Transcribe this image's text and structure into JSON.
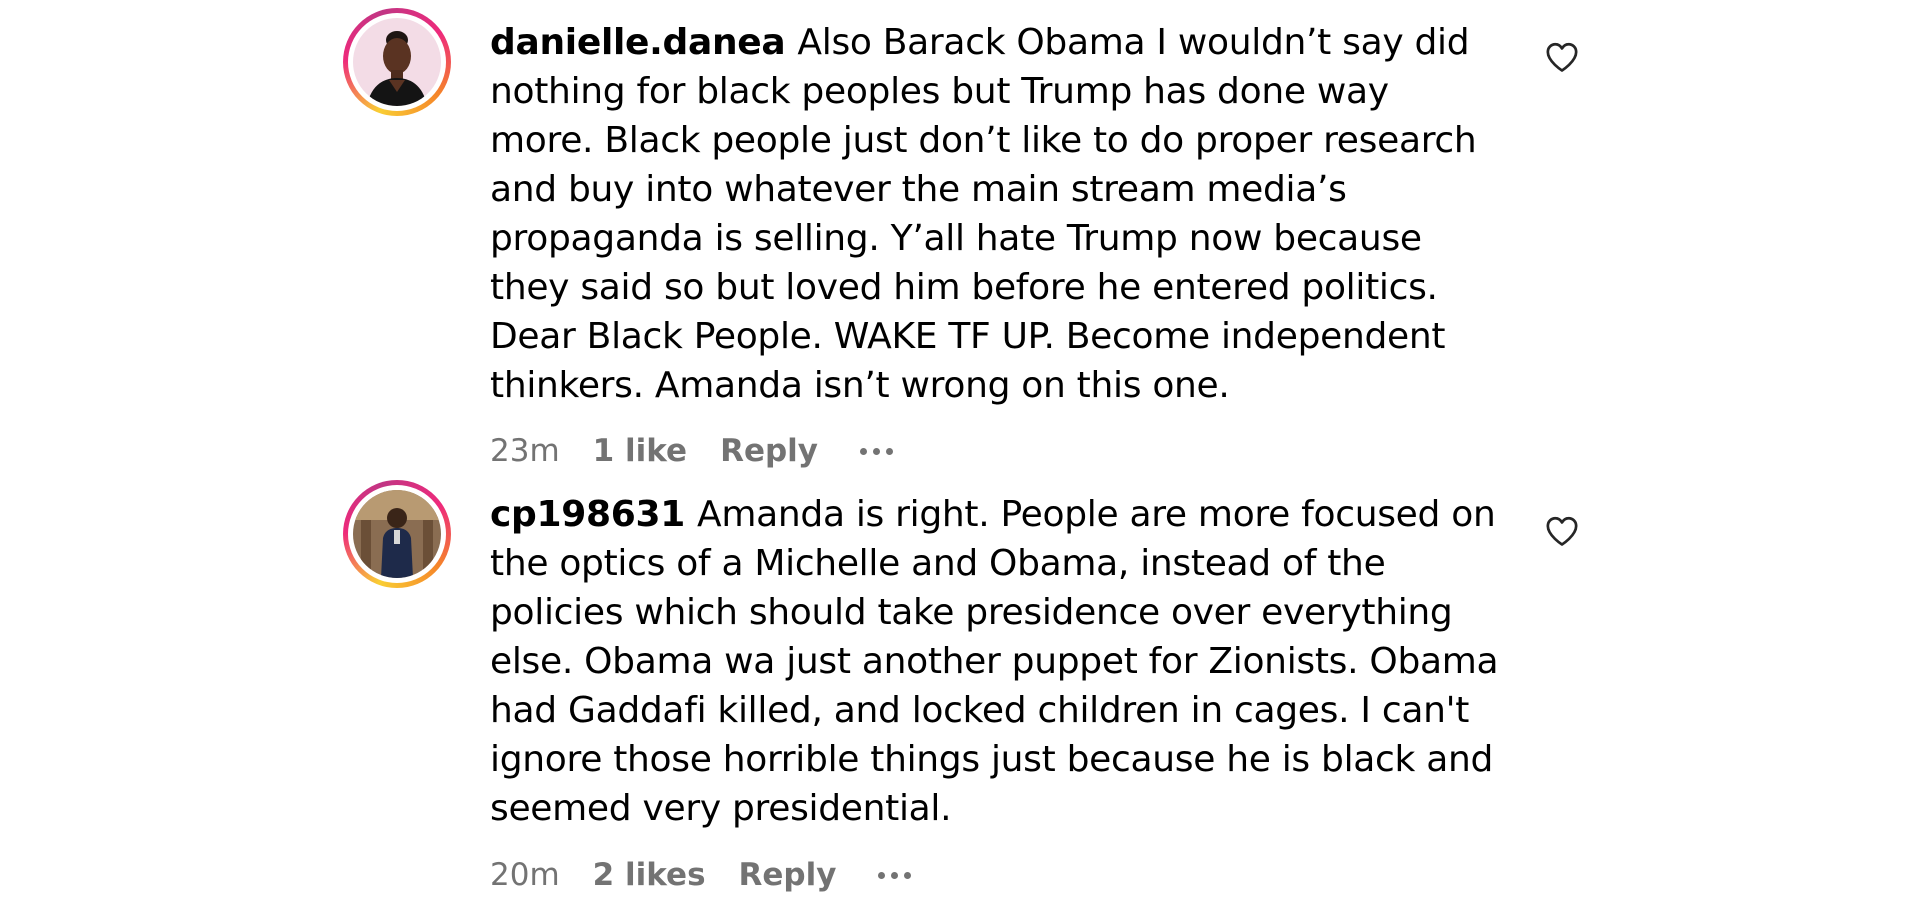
{
  "comments": [
    {
      "username": "danielle.danea",
      "text": "Also Barack Obama I wouldn’t say did nothing for black peoples but Trump has done way more. Black people just don’t like to do proper research and buy into whatever the main stream media’s propaganda is selling. Y’all hate Trump now because they said so but loved him before he entered politics. Dear Black People. WAKE TF UP. Become independent thinkers. Amanda isn’t wrong on this one.",
      "time": "23m",
      "likes": "1 like",
      "reply_label": "Reply",
      "avatar_icon": "profile-photo-woman"
    },
    {
      "username": "cp198631",
      "text": "Amanda is right. People are more focused on the optics of a Michelle and Obama, instead of the policies which should take presidence over everything else. Obama wa just another puppet for Zionists. Obama had Gaddafi killed, and locked children in cages. I can't ignore those horrible things just because he is black and seemed very presidential.",
      "time": "20m",
      "likes": "2 likes",
      "reply_label": "Reply",
      "avatar_icon": "profile-photo-man"
    }
  ],
  "icons": {
    "like": "heart-outline-icon",
    "more": "more-options-icon"
  },
  "colors": {
    "text": "#000000",
    "meta": "#737373",
    "story_ring_start": "#f9ce34",
    "story_ring_mid": "#ee2a7b",
    "story_ring_end": "#c13584"
  }
}
